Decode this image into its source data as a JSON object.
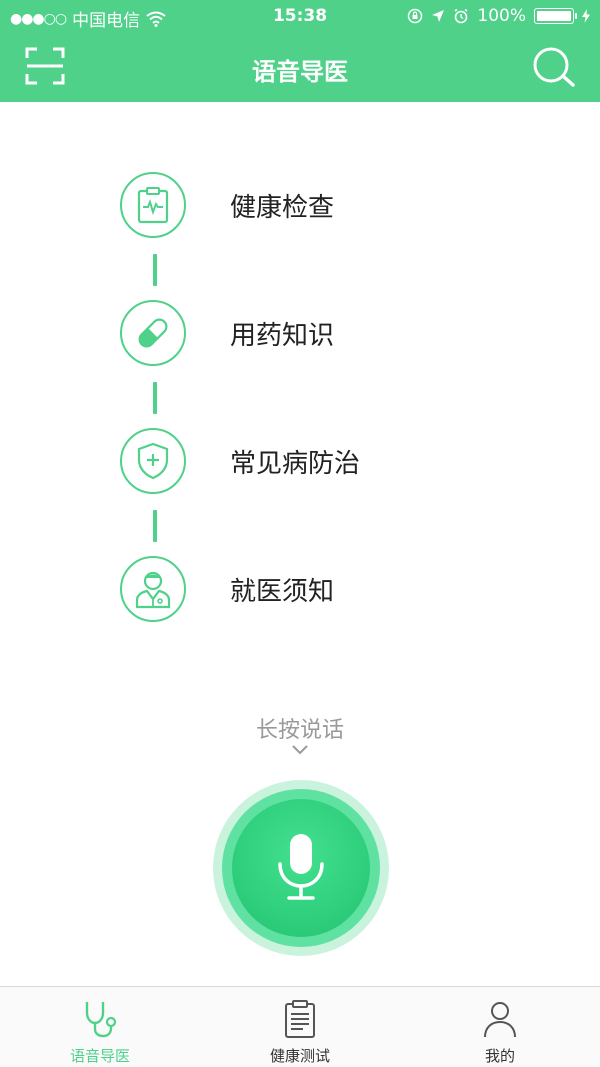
{
  "status_bar": {
    "carrier": "中国电信",
    "time": "15:38",
    "battery": "100%"
  },
  "nav": {
    "title": "语音导医",
    "left_icon": "scan-icon",
    "right_icon": "search-icon"
  },
  "menu": {
    "items": [
      {
        "label": "健康检查",
        "icon": "clipboard-pulse-icon"
      },
      {
        "label": "用药知识",
        "icon": "pill-icon"
      },
      {
        "label": "常见病防治",
        "icon": "shield-plus-icon"
      },
      {
        "label": "就医须知",
        "icon": "doctor-icon"
      }
    ]
  },
  "voice": {
    "hint": "长按说话",
    "icon": "microphone-icon"
  },
  "tabbar": {
    "tabs": [
      {
        "label": "语音导医",
        "icon": "stethoscope-icon",
        "active": true
      },
      {
        "label": "健康测试",
        "icon": "clipboard-list-icon",
        "active": false
      },
      {
        "label": "我的",
        "icon": "user-icon",
        "active": false
      }
    ]
  },
  "colors": {
    "accent": "#4fd18a",
    "mic": "#2fcf7d",
    "hint_text": "#9a9a9a"
  }
}
